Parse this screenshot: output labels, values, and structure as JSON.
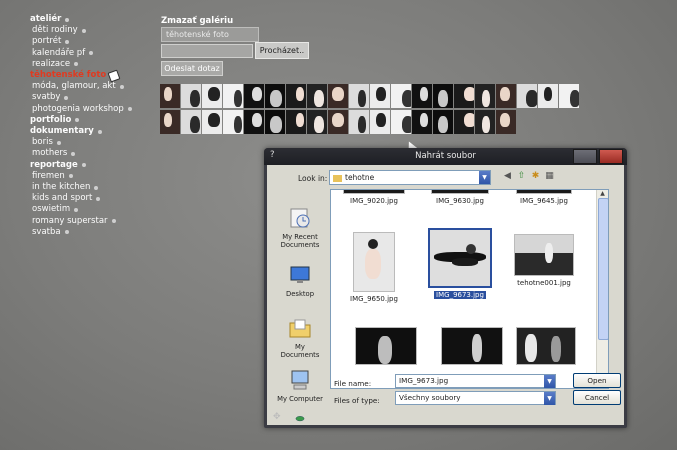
{
  "nav": {
    "items": [
      {
        "label": "ateliér",
        "style": "bold"
      },
      {
        "label": "děti rodiny",
        "style": "ind"
      },
      {
        "label": "portrét",
        "style": "ind"
      },
      {
        "label": "kalendáře pf",
        "style": "ind"
      },
      {
        "label": "realizace",
        "style": "ind"
      },
      {
        "label": "těhotenské foto",
        "style": "active"
      },
      {
        "label": "móda, glamour, akt",
        "style": "ind"
      },
      {
        "label": "svatby",
        "style": "ind"
      },
      {
        "label": "photogenia workshop",
        "style": "ind"
      },
      {
        "label": "portfolio",
        "style": "bold"
      },
      {
        "label": "dokumentary",
        "style": "bold"
      },
      {
        "label": "boris",
        "style": "ind"
      },
      {
        "label": "mothers",
        "style": "ind"
      },
      {
        "label": "reportage",
        "style": "bold"
      },
      {
        "label": "firemen",
        "style": "ind"
      },
      {
        "label": "in the kitchen",
        "style": "ind"
      },
      {
        "label": "kids and sport",
        "style": "ind"
      },
      {
        "label": "oswietim",
        "style": "ind"
      },
      {
        "label": "romany superstar",
        "style": "ind"
      },
      {
        "label": "svatba",
        "style": "ind"
      }
    ],
    "active_color": "#e03a20"
  },
  "form": {
    "gallery_label": "Zmazať galériu",
    "gallery_value": "těhotenské foto",
    "browse_label": "Procházet..",
    "submit_label": "Odeslat dotaz"
  },
  "thumbnails": {
    "row1_count": 20,
    "row2_count": 17
  },
  "dialog": {
    "title": "Nahrát soubor",
    "help": "?",
    "lookin_label": "Look in:",
    "lookin_value": "tehotne",
    "places": [
      {
        "label": "My Recent Documents",
        "icon": "recent-documents-icon"
      },
      {
        "label": "Desktop",
        "icon": "desktop-icon"
      },
      {
        "label": "My Documents",
        "icon": "my-documents-icon"
      },
      {
        "label": "My Computer",
        "icon": "my-computer-icon"
      }
    ],
    "files": [
      {
        "name": "IMG_9020.jpg",
        "selected": false
      },
      {
        "name": "IMG_9630.jpg",
        "selected": false
      },
      {
        "name": "IMG_9645.jpg",
        "selected": false
      },
      {
        "name": "IMG_9650.jpg",
        "selected": false
      },
      {
        "name": "IMG_9673.jpg",
        "selected": true
      },
      {
        "name": "tehotne001.jpg",
        "selected": false
      }
    ],
    "filename_label": "File name:",
    "filename_value": "IMG_9673.jpg",
    "filetype_label": "Files of type:",
    "filetype_value": "Všechny soubory",
    "open_label": "Open",
    "cancel_label": "Cancel",
    "selection_color": "#2a4f9e"
  }
}
